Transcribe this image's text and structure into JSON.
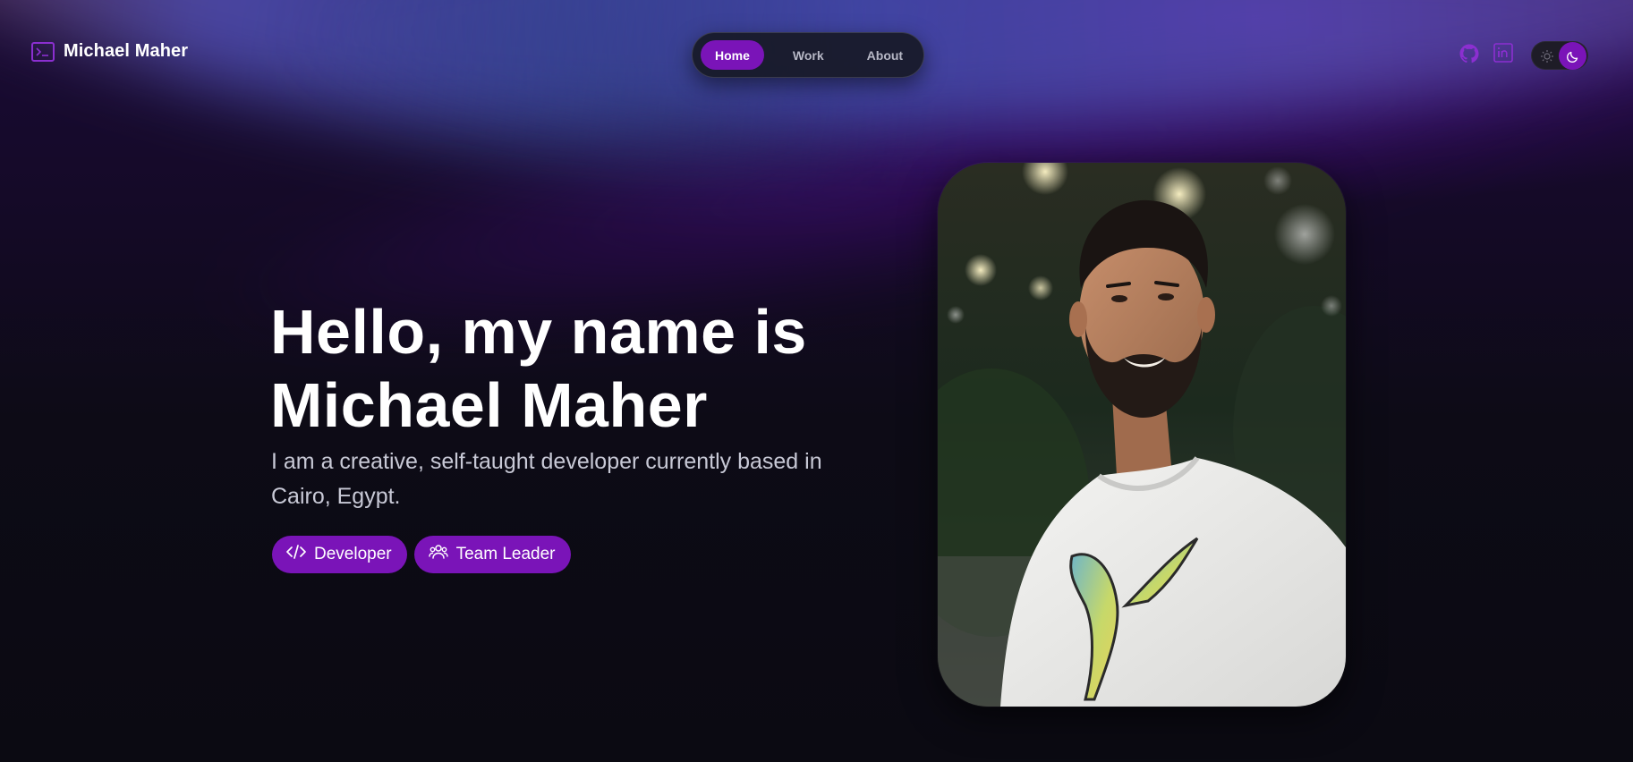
{
  "header": {
    "logo_text": "Michael Maher",
    "logo_icon": "terminal-icon"
  },
  "nav": {
    "items": [
      {
        "label": "Home",
        "active": true
      },
      {
        "label": "Work",
        "active": false
      },
      {
        "label": "About",
        "active": false
      }
    ]
  },
  "social": {
    "github_icon": "github-icon",
    "linkedin_icon": "linkedin-icon"
  },
  "theme_toggle": {
    "mode": "dark",
    "icons": [
      "sun-icon",
      "moon-icon"
    ]
  },
  "hero": {
    "title_line1": "Hello, my name is",
    "title_line2": "Michael Maher",
    "subtitle": "I am a creative, self-taught developer currently based in Cairo, Egypt.",
    "tags": [
      {
        "label": "Developer",
        "icon": "code-icon"
      },
      {
        "label": "Team Leader",
        "icon": "users-icon"
      }
    ]
  },
  "colors": {
    "accent": "#7a14b8",
    "background": "#0b0a12"
  }
}
